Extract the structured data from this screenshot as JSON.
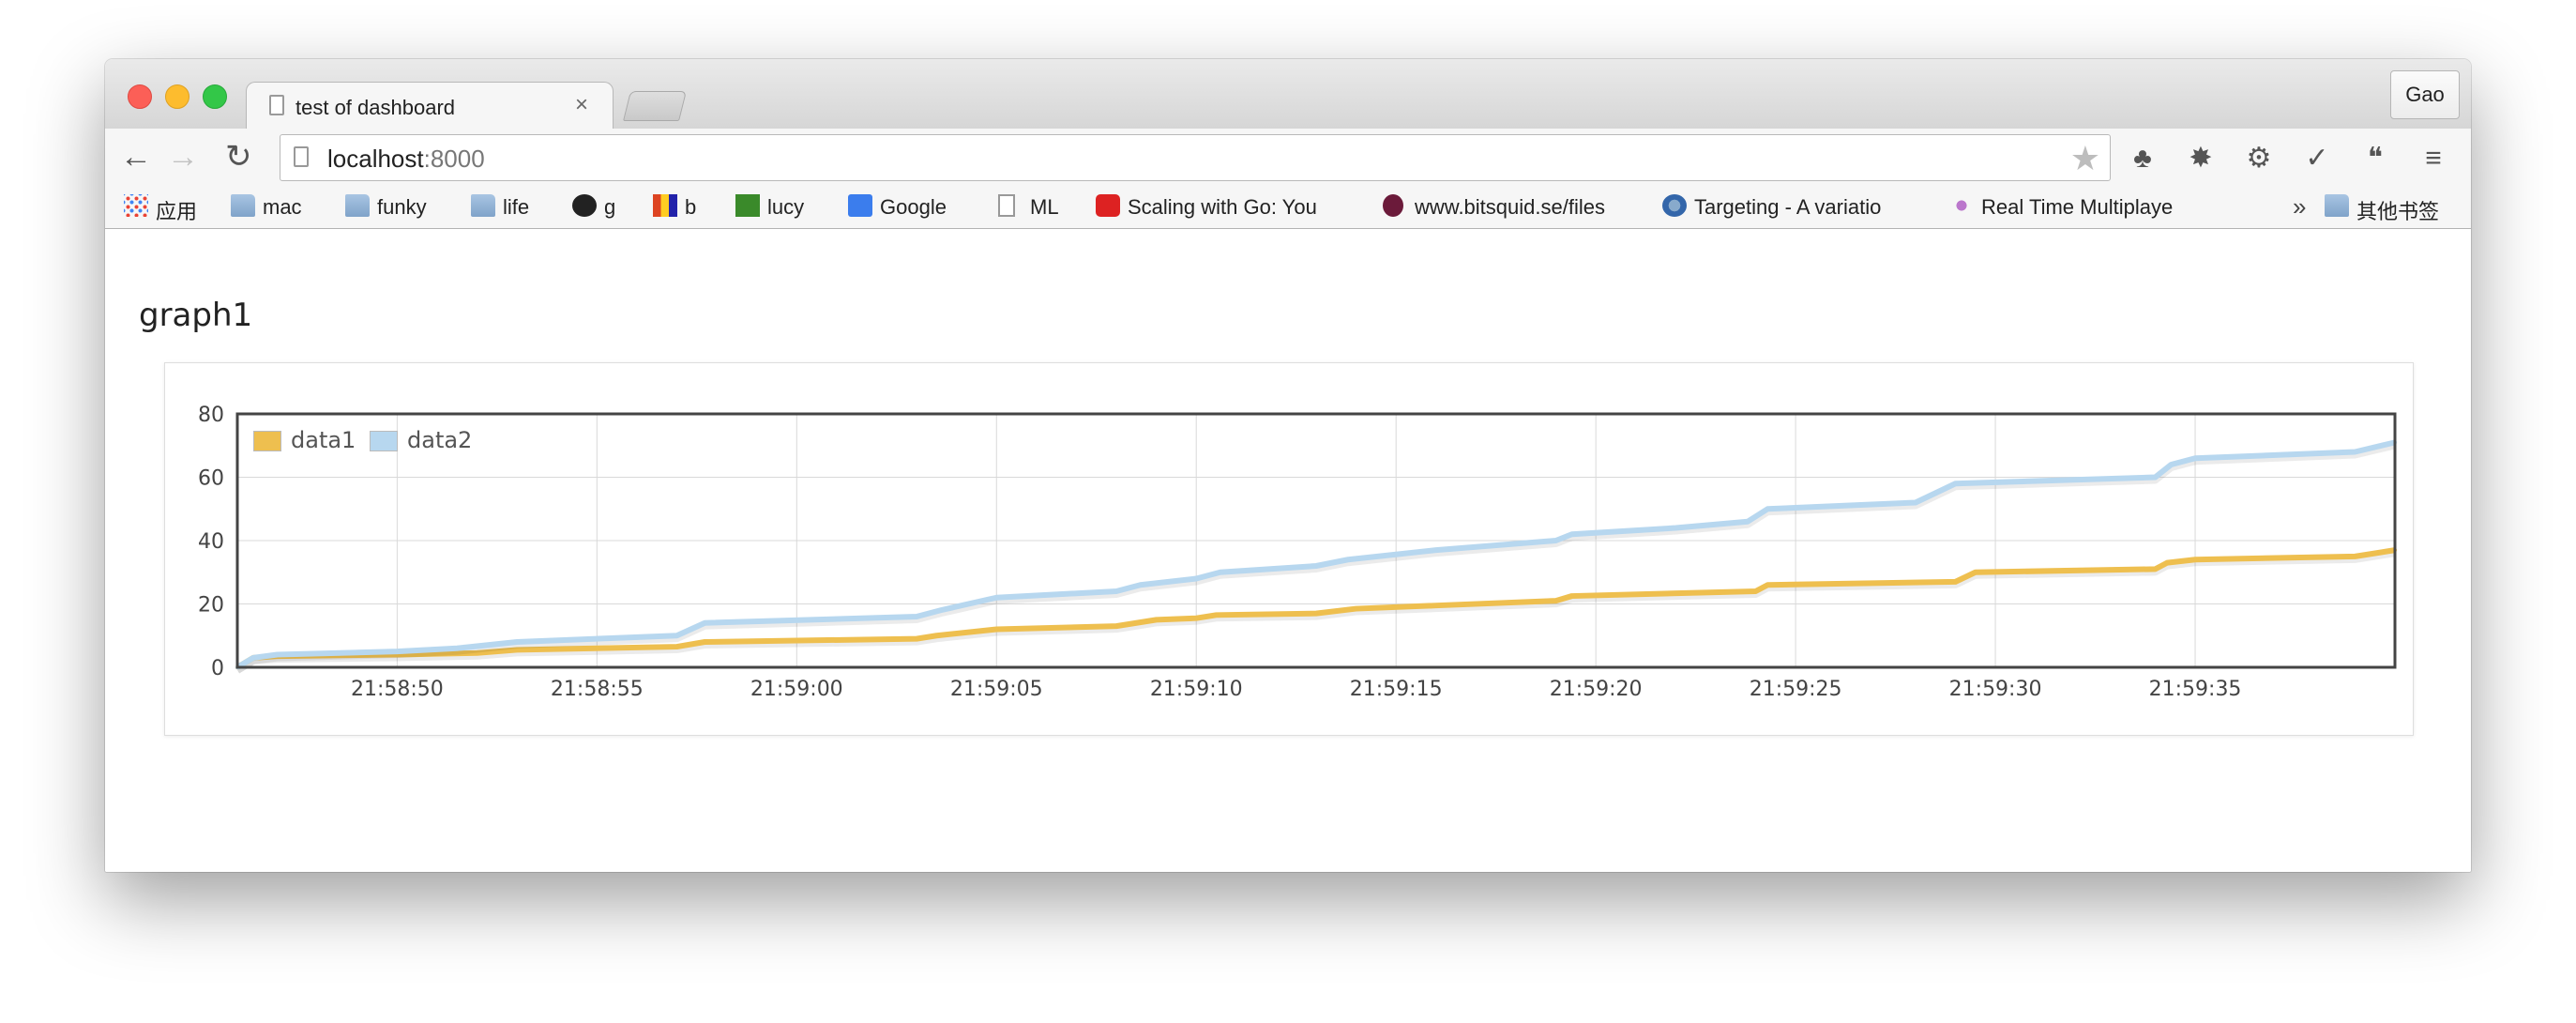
{
  "window": {
    "tab_title": "test of dashboard",
    "tab_close": "×",
    "profile_label": "Gao"
  },
  "toolbar": {
    "back_icon": "←",
    "forward_icon": "→",
    "reload_icon": "↻",
    "url_host": "localhost",
    "url_port": ":8000",
    "star_icon": "★",
    "extensions": [
      {
        "name": "evernote-icon",
        "glyph": "♣"
      },
      {
        "name": "firebug-icon",
        "glyph": "✸"
      },
      {
        "name": "gear-icon",
        "glyph": "⚙"
      },
      {
        "name": "check-icon",
        "glyph": "✓"
      },
      {
        "name": "chat-icon",
        "glyph": "❝"
      },
      {
        "name": "menu-icon",
        "glyph": "≡"
      }
    ]
  },
  "bookmarks": [
    {
      "label": "应用",
      "icon": "apps-grid-icon"
    },
    {
      "label": "mac",
      "icon": "folder-icon"
    },
    {
      "label": "funky",
      "icon": "folder-icon"
    },
    {
      "label": "life",
      "icon": "folder-icon"
    },
    {
      "label": "g",
      "icon": "github-icon"
    },
    {
      "label": "b",
      "icon": "b-site-icon"
    },
    {
      "label": "lucy",
      "icon": "star-site-icon"
    },
    {
      "label": "Google",
      "icon": "google-icon"
    },
    {
      "label": "ML",
      "icon": "page-icon"
    },
    {
      "label": "Scaling with Go: You",
      "icon": "youtube-icon"
    },
    {
      "label": "www.bitsquid.se/files",
      "icon": "bitsquid-icon"
    },
    {
      "label": "Targeting - A variatio",
      "icon": "targeting-icon"
    },
    {
      "label": "Real Time Multiplaye",
      "icon": "realtime-icon"
    }
  ],
  "bookmarks_overflow": "»",
  "bookmarks_other": "其他书签",
  "page": {
    "graph_title": "graph1"
  },
  "chart_data": {
    "type": "area",
    "title": "",
    "xlabel": "",
    "ylabel": "",
    "ylim": [
      0,
      80
    ],
    "yticks": [
      0,
      20,
      40,
      60,
      80
    ],
    "xticks": [
      "21:58:50",
      "21:58:55",
      "21:59:00",
      "21:59:05",
      "21:59:10",
      "21:59:15",
      "21:59:20",
      "21:59:25",
      "21:59:30",
      "21:59:35"
    ],
    "x_start": "21:58:46",
    "x_end": "21:59:40",
    "legend_position": "top-left",
    "grid": true,
    "series": [
      {
        "name": "data1",
        "color": "#eebf4f",
        "points": [
          [
            "21:58:46",
            0
          ],
          [
            "21:58:46.4",
            3
          ],
          [
            "21:58:47",
            3.5
          ],
          [
            "21:58:50",
            4
          ],
          [
            "21:58:52",
            4.5
          ],
          [
            "21:58:53",
            5.5
          ],
          [
            "21:58:57",
            6.5
          ],
          [
            "21:58:57.7",
            8
          ],
          [
            "21:59:03",
            9
          ],
          [
            "21:59:03.5",
            10
          ],
          [
            "21:59:05",
            12
          ],
          [
            "21:59:08",
            13
          ],
          [
            "21:59:09",
            15
          ],
          [
            "21:59:10",
            15.5
          ],
          [
            "21:59:10.5",
            16.5
          ],
          [
            "21:59:13",
            17
          ],
          [
            "21:59:14",
            18.5
          ],
          [
            "21:59:16",
            19.5
          ],
          [
            "21:59:19",
            21
          ],
          [
            "21:59:19.4",
            22.5
          ],
          [
            "21:59:24",
            24
          ],
          [
            "21:59:24.3",
            26
          ],
          [
            "21:59:29",
            27
          ],
          [
            "21:59:29.5",
            30
          ],
          [
            "21:59:34",
            31
          ],
          [
            "21:59:34.3",
            33
          ],
          [
            "21:59:35",
            34
          ],
          [
            "21:59:39",
            35
          ],
          [
            "21:59:40",
            37
          ]
        ]
      },
      {
        "name": "data2",
        "color": "#b7d7ef",
        "points": [
          [
            "21:58:46",
            0
          ],
          [
            "21:58:46.4",
            3
          ],
          [
            "21:58:47",
            4
          ],
          [
            "21:58:50",
            5
          ],
          [
            "21:58:51.5",
            6
          ],
          [
            "21:58:53",
            8
          ],
          [
            "21:58:57",
            10
          ],
          [
            "21:58:57.7",
            14
          ],
          [
            "21:59:03",
            16
          ],
          [
            "21:59:03.6",
            18
          ],
          [
            "21:59:05",
            22
          ],
          [
            "21:59:08",
            24
          ],
          [
            "21:59:08.6",
            26
          ],
          [
            "21:59:10",
            28
          ],
          [
            "21:59:10.6",
            30
          ],
          [
            "21:59:13",
            32
          ],
          [
            "21:59:13.8",
            34
          ],
          [
            "21:59:16",
            37
          ],
          [
            "21:59:19",
            40
          ],
          [
            "21:59:19.4",
            42
          ],
          [
            "21:59:22",
            44
          ],
          [
            "21:59:23.8",
            46
          ],
          [
            "21:59:24.3",
            50
          ],
          [
            "21:59:28",
            52
          ],
          [
            "21:59:29",
            58
          ],
          [
            "21:59:34",
            60
          ],
          [
            "21:59:34.4",
            64
          ],
          [
            "21:59:35",
            66
          ],
          [
            "21:59:39",
            68
          ],
          [
            "21:59:40",
            71
          ]
        ]
      }
    ]
  }
}
